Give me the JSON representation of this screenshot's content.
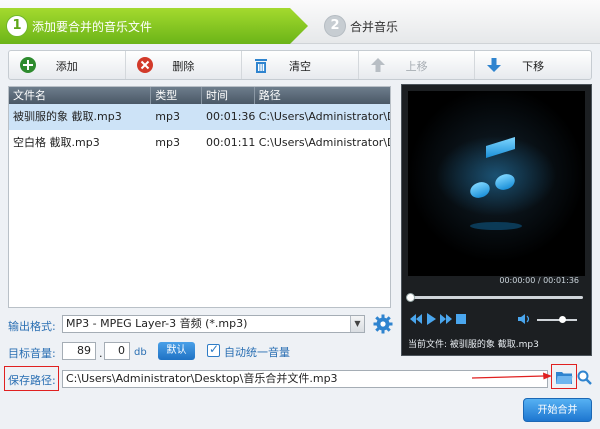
{
  "steps": {
    "step1_number": "1",
    "step1_label": "添加要合并的音乐文件",
    "step2_number": "2",
    "step2_label": "合并音乐"
  },
  "toolbar": {
    "add": "添加",
    "delete": "删除",
    "clear": "清空",
    "move_up": "上移",
    "move_down": "下移"
  },
  "file_list": {
    "columns": [
      "文件名",
      "类型",
      "时间",
      "路径"
    ],
    "rows": [
      {
        "name": "被驯服的象 截取.mp3",
        "type": "mp3",
        "time": "00:01:36",
        "path": "C:\\Users\\Administrator\\D..."
      },
      {
        "name": "空白格 截取.mp3",
        "type": "mp3",
        "time": "00:01:11",
        "path": "C:\\Users\\Administrator\\D..."
      }
    ]
  },
  "player": {
    "time": "00:00:00 / 00:01:36",
    "current_file": "当前文件: 被驯服的象 截取.mp3",
    "progress_fraction": 0.0
  },
  "output": {
    "format_label": "输出格式:",
    "format_value": "MP3 - MPEG Layer-3 音频 (*.mp3)",
    "volume_label": "目标音量:",
    "volume_int": "89",
    "volume_dec": "0",
    "volume_sep": ".",
    "volume_unit": "db",
    "default_button": "默认",
    "auto_unify_label": "自动统一音量",
    "save_path_label": "保存路径:",
    "save_path_value": "C:\\Users\\Administrator\\Desktop\\音乐合并文件.mp3",
    "start_button": "开始合并"
  },
  "colors": {
    "step_active": "#7cc31e",
    "accent_blue": "#1f72c4",
    "highlight_red": "#e02020"
  }
}
